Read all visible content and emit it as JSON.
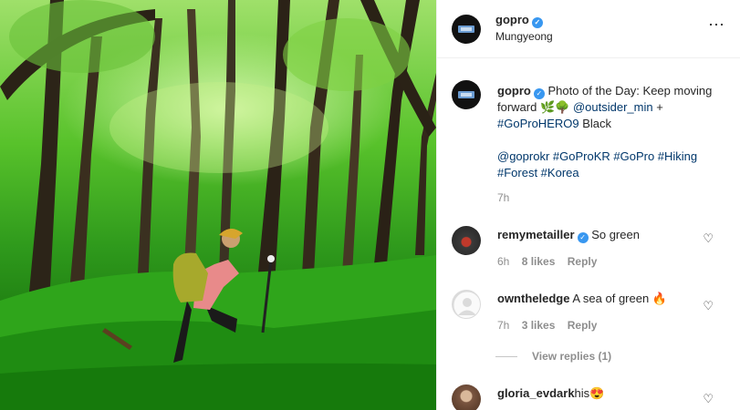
{
  "post": {
    "username": "gopro",
    "location": "Mungyeong",
    "more_icon": "⋯"
  },
  "caption": {
    "username": "gopro",
    "text_intro": "Photo of the Day: Keep moving forward",
    "emoji": "🌿🌳",
    "mention": "@outsider_min",
    "plus": "+",
    "tag_hero": "#GoProHERO9",
    "black": "Black",
    "line2_mention": "@goprokr",
    "line2_tags": "#GoProKR #GoPro #Hiking #Forest #Korea",
    "time": "7h"
  },
  "comments": [
    {
      "username": "remymetailler",
      "verified": true,
      "text": "So green",
      "time": "6h",
      "likes": "8 likes",
      "reply": "Reply"
    },
    {
      "username": "owntheledge",
      "verified": false,
      "text": "A sea of green 🔥",
      "time": "7h",
      "likes": "3 likes",
      "reply": "Reply"
    },
    {
      "username": "gloria_evdark",
      "verified": false,
      "text": "his😍",
      "time": "",
      "likes": "",
      "reply": ""
    }
  ],
  "view_replies": "View replies (1)",
  "icons": {
    "heart": "heart-outline-icon",
    "verified": "verified-badge-icon"
  },
  "colors": {
    "link": "#00376b",
    "verified": "#3897f0",
    "muted": "#8e8e8e"
  }
}
